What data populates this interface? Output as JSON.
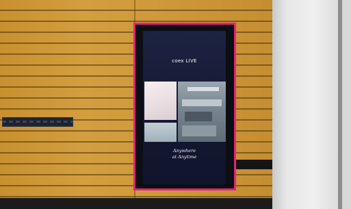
{
  "kiosk": {
    "logo_text": "coex LIVE",
    "tagline": [
      "Anywhere",
      "at Anytime"
    ]
  },
  "colors": {
    "kiosk_frame": "#e3247a",
    "wall_wood": "#cf9a3b",
    "screen_bg": "#1d2342"
  }
}
